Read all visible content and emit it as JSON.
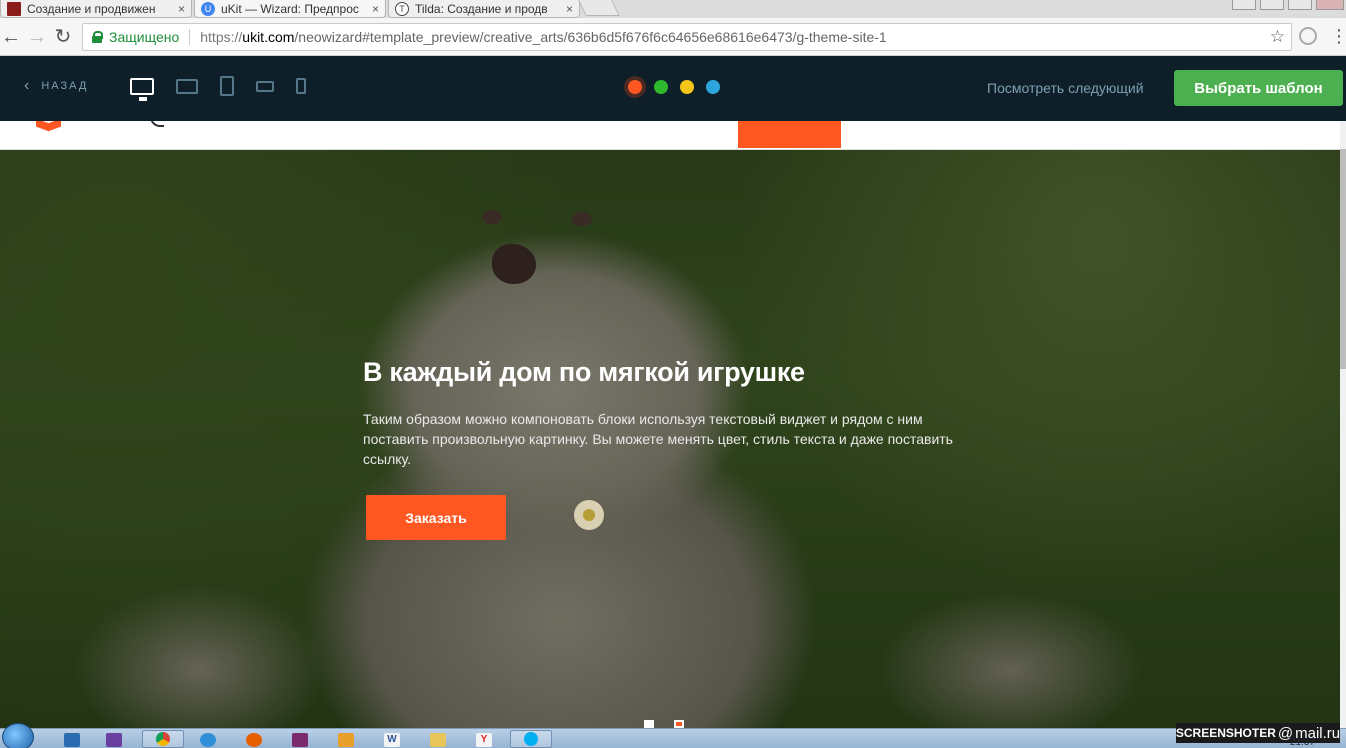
{
  "browser": {
    "tabs": [
      {
        "title": "Создание и продвижен",
        "favicon": "red-square-favicon",
        "active": false
      },
      {
        "title": "uKit — Wizard: Предпрос",
        "favicon": "ukit-favicon",
        "active": true
      },
      {
        "title": "Tilda: Создание и продв",
        "favicon": "tilda-favicon",
        "active": false
      }
    ],
    "tab_close": "×",
    "omnibox": {
      "secure_label": "Защищено",
      "url_scheme": "https://",
      "url_host": "ukit.com",
      "url_path": "/neowizard#template_preview/creative_arts/636b6d5f676f6c64656e68616e6473/g-theme-site-1"
    },
    "icons": {
      "back": "←",
      "forward": "→",
      "reload": "↻",
      "star": "☆",
      "menu": "⋮"
    }
  },
  "wizard": {
    "back_label": "НАЗАД",
    "back_chevron": "‹",
    "devices": [
      "desktop-icon",
      "tablet-landscape-icon",
      "tablet-portrait-icon",
      "phone-landscape-icon",
      "phone-portrait-icon"
    ],
    "color_options": [
      "#ff5722",
      "#2db82d",
      "#f5c518",
      "#2ba6de"
    ],
    "selected_color": "#ff5722",
    "next_label": "Посмотреть следующий",
    "choose_label": "Выбрать шаблон"
  },
  "hero": {
    "title": "В каждый дом по мягкой игрушке",
    "text": "Таким образом можно компоновать блоки используя текстовый виджет и рядом с ним поставить произвольную картинку. Вы можете менять цвет, стиль текста и даже поставить ссылку.",
    "button_label": "Заказать",
    "slides": 2,
    "active_slide": 1
  },
  "taskbar": {
    "apps": [
      "outlook-icon",
      "visual-studio-icon",
      "chrome-icon",
      "ie-icon",
      "firefox-icon",
      "winrar-icon",
      "media-player-icon",
      "word-icon",
      "explorer-icon",
      "yandex-icon",
      "skype-icon"
    ],
    "watermark_left": "SCREENSHOTER",
    "watermark_at": "@",
    "watermark_right": "mail.ru",
    "time": "21:37"
  }
}
